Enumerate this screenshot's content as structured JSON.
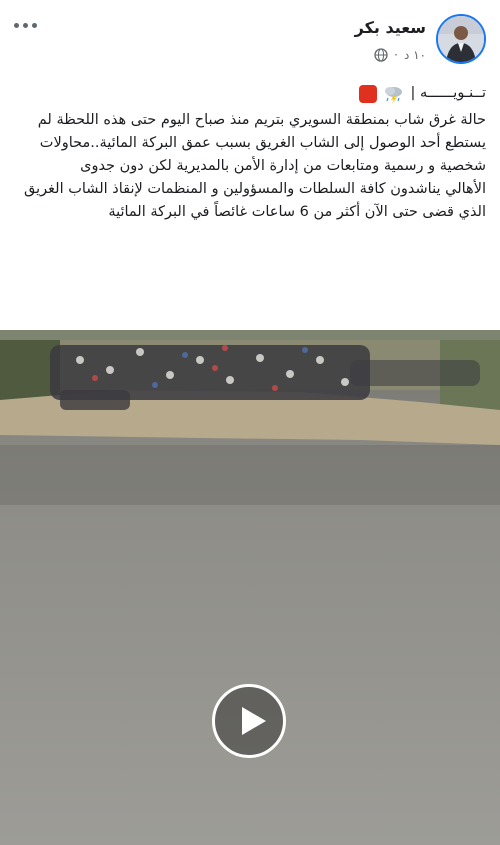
{
  "post": {
    "author": "سعيد بكر",
    "time": "١٠ د",
    "audience_icon": "globe-icon",
    "notice_title": "تــنـويــــــه |",
    "paragraph1": "حالة غرق شاب بمنطقة السويري بتريم منذ صباح اليوم حتى هذه اللحظة لم يستطع أحد الوصول إلى الشاب الغريق بسبب عمق البركة المائية..محاولات شخصية و رسمية ومتابعات من إدارة الأمن بالمديرية لكن دون جدوى",
    "paragraph2": "الأهالي يناشدون كافة السلطات والمسؤولين و المنظمات لإنقاذ الشاب الغريق الذي قضى حتى الآن أكثر من 6 ساعات غائصاً في البركة المائية"
  },
  "video": {
    "play_icon": "play-icon"
  },
  "colors": {
    "accent": "#1877f2",
    "alert_red": "#e0311f",
    "text": "#1c1e21",
    "secondary": "#65676b"
  }
}
